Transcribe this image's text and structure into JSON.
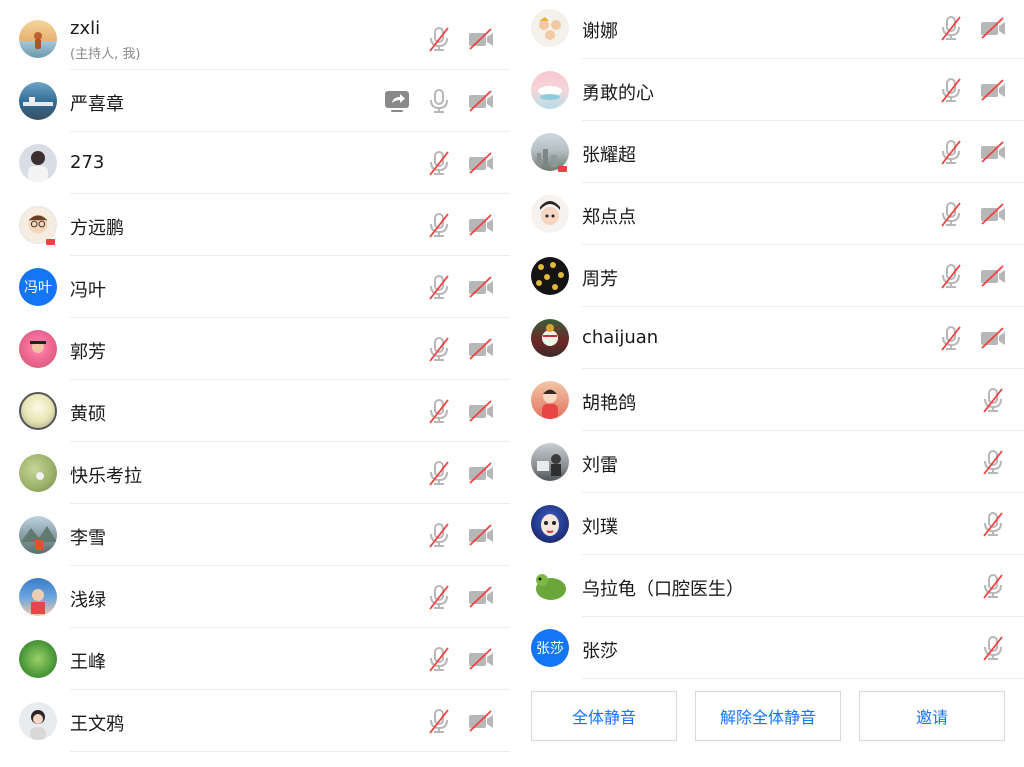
{
  "colors": {
    "accent": "#1476f5",
    "muted_icon": "#b7b7b7",
    "strike": "#f24040"
  },
  "left": {
    "participants": [
      {
        "name": "zxli",
        "subtitle": "(主持人, 我)",
        "avatar": "beach-photo"
      },
      {
        "name": "严喜章",
        "avatar": "harbor-photo",
        "sharing": true,
        "mic_on": true
      },
      {
        "name": "273",
        "avatar": "woman-photo"
      },
      {
        "name": "方远鹏",
        "avatar": "cartoon-doctor"
      },
      {
        "name": "冯叶",
        "avatar_text": "冯叶"
      },
      {
        "name": "郭芳",
        "avatar": "pink-photo"
      },
      {
        "name": "黄硕",
        "avatar": "moon-photo"
      },
      {
        "name": "快乐考拉",
        "avatar": "field-photo"
      },
      {
        "name": "李雪",
        "avatar": "mountain-photo"
      },
      {
        "name": "浅绿",
        "avatar": "blue-photo"
      },
      {
        "name": "王峰",
        "avatar": "leaves-photo"
      },
      {
        "name": "王文鸦",
        "avatar": "portrait-photo"
      }
    ]
  },
  "right": {
    "participants": [
      {
        "name": "谢娜",
        "avatar": "cartoon-family"
      },
      {
        "name": "勇敢的心",
        "avatar": "cloud-illustration"
      },
      {
        "name": "张耀超",
        "avatar": "city-photo"
      },
      {
        "name": "郑点点",
        "avatar": "baby-photo"
      },
      {
        "name": "周芳",
        "avatar": "dots-photo"
      },
      {
        "name": "chaijuan",
        "avatar": "opera-photo"
      },
      {
        "name": "胡艳鸽",
        "avatar": "child-photo",
        "no_video": true
      },
      {
        "name": "刘雷",
        "avatar": "street-photo",
        "no_video": true
      },
      {
        "name": "刘璞",
        "avatar": "mask-photo",
        "no_video": true
      },
      {
        "name": "乌拉龟（口腔医生）",
        "avatar": "turtle-photo",
        "no_video": true
      },
      {
        "name": "张莎",
        "avatar_text": "张莎",
        "no_video": true
      }
    ]
  },
  "actions": {
    "mute_all": "全体静音",
    "unmute_all": "解除全体静音",
    "invite": "邀请"
  }
}
